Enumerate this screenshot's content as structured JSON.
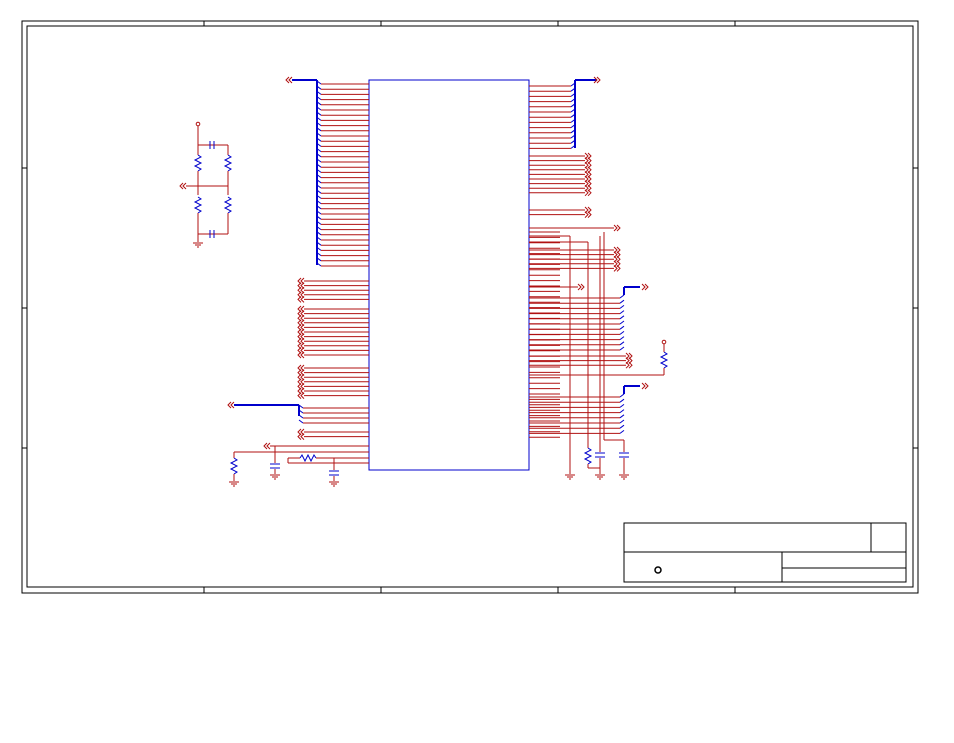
{
  "schematic": {
    "colors": {
      "wire": "#b01010",
      "bus": "#0000cc",
      "component": "#0000cc",
      "frame": "#000000",
      "background": "#ffffff"
    },
    "icons": {
      "offpage_connector": "offpage-connector-icon",
      "ground": "ground-icon",
      "resistor": "resistor-icon",
      "capacitor": "capacitor-icon",
      "power_pin": "power-pin-icon",
      "logo": "logo-ring-icon"
    },
    "title_block": {
      "title": "",
      "size": "",
      "document_number": "",
      "revision": "",
      "date": "",
      "sheet": ""
    }
  }
}
